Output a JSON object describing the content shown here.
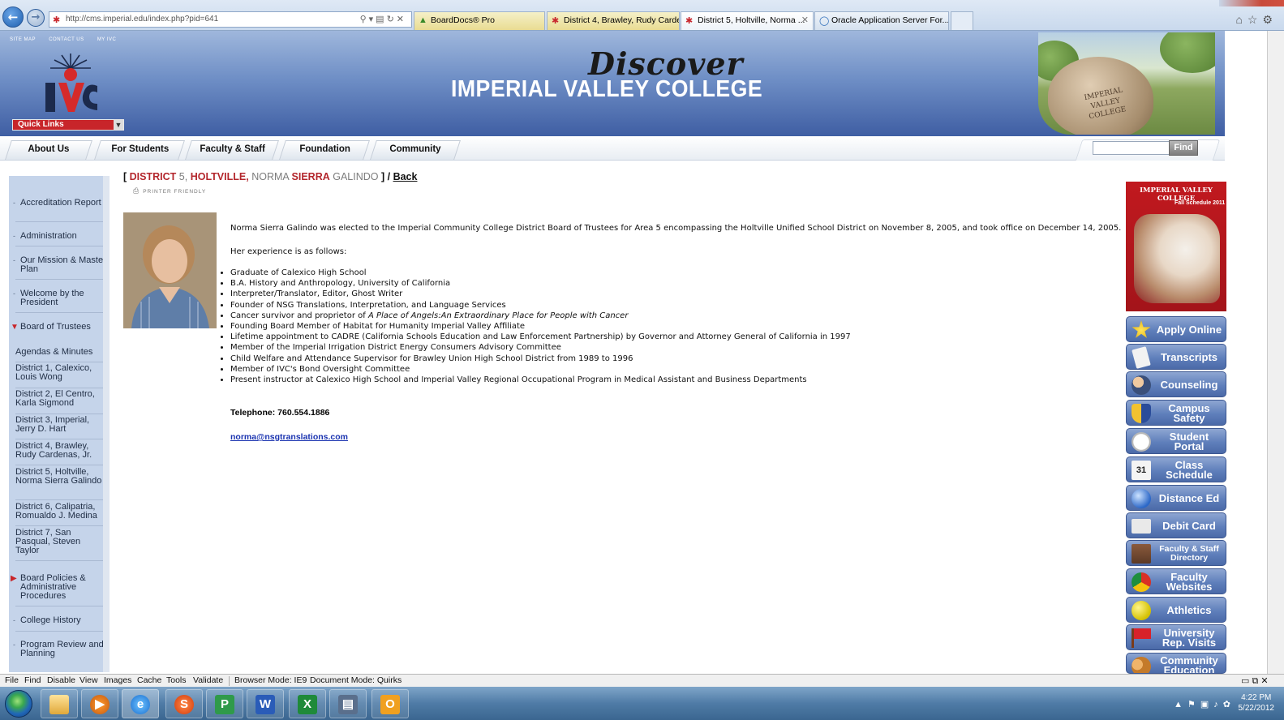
{
  "browser": {
    "url": "http://cms.imperial.edu/index.php?pid=641",
    "tabs": [
      {
        "label": "BoardDocs® Pro",
        "icon": "boarddocs-icon"
      },
      {
        "label": "District 4, Brawley, Rudy Carde...",
        "icon": "ivc-favicon"
      },
      {
        "label": "District 5, Holtville, Norma ...",
        "icon": "ivc-favicon",
        "active": true
      },
      {
        "label": "Oracle Application Server For...",
        "icon": "ie-icon"
      }
    ]
  },
  "header": {
    "util_links": [
      "SITE MAP",
      "CONTACT US",
      "MY IVC"
    ],
    "quick_links": "Quick Links",
    "discover": "Discover",
    "college_name": "IMPERIAL VALLEY COLLEGE",
    "photo_sign": "IMPERIAL VALLEY COLLEGE"
  },
  "nav": {
    "items": [
      "About Us",
      "For Students",
      "Faculty & Staff",
      "Foundation",
      "Community"
    ],
    "find_label": "Find",
    "search_value": ""
  },
  "sidebar": {
    "items": [
      {
        "label": "Accreditation Report"
      },
      {
        "label": "Administration"
      },
      {
        "label": "Our Mission & Master Plan"
      },
      {
        "label": "Welcome by the President"
      },
      {
        "label": "Board of Trustees"
      },
      {
        "label": "Agendas & Minutes"
      },
      {
        "label": "District 1, Calexico, Louis Wong"
      },
      {
        "label": "District 2, El Centro, Karla Sigmond"
      },
      {
        "label": "District 3, Imperial, Jerry D. Hart"
      },
      {
        "label": "District 4, Brawley, Rudy Cardenas, Jr."
      },
      {
        "label": "District 5, Holtville, Norma Sierra Galindo"
      },
      {
        "label": "District 6, Calipatria, Romualdo J. Medina"
      },
      {
        "label": "District 7, San Pasqual, Steven Taylor"
      },
      {
        "label": "Board Policies & Administrative Procedures"
      },
      {
        "label": "College History"
      },
      {
        "label": "Program Review and Planning"
      }
    ]
  },
  "main": {
    "title": {
      "open_bracket": "[",
      "district": "DISTRICT",
      "district_num": "5,",
      "city": "HOLTVILLE,",
      "first": "NORMA",
      "middle": "SIERRA",
      "last": "GALINDO",
      "close": "] /",
      "back": "Back"
    },
    "printer_friendly": "PRINTER FRIENDLY",
    "intro": "Norma Sierra Galindo was elected to the Imperial Community College District Board of Trustees for Area 5 encompassing the Holtville Unified School District on November 8, 2005, and took office on December 14, 2005.",
    "experience_heading": "Her experience is as follows:",
    "experience": [
      "Graduate of Calexico High School",
      "B.A. History and Anthropology, University of California",
      "Interpreter/Translator, Editor, Ghost Writer",
      "Founder of NSG Translations, Interpretation, and Language Services",
      "Cancer survivor and proprietor of ",
      "Founding Board Member of Habitat for Humanity Imperial Valley Affiliate",
      "Lifetime appointment to CADRE (California Schools Education and Law Enforcement Partnership) by Governor and Attorney General of California in 1997",
      "Member of the Imperial Irrigation District Energy Consumers Advisory Committee",
      "Child Welfare and Attendance Supervisor for Brawley Union High School District from 1989 to 1996",
      "Member of IVC's Bond Oversight Committee",
      "Present instructor at Calexico High School and Imperial Valley Regional Occupational Program in Medical Assistant and Business Departments"
    ],
    "book_title": "A Place of Angels:An Extraordinary Place for People with Cancer",
    "telephone": "Telephone: 760.554.1886",
    "email": "norma@nsgtranslations.com"
  },
  "right": {
    "ad_title": "IMPERIAL VALLEY COLLEGE",
    "ad_subtitle": "Fall Schedule 2011",
    "buttons": [
      {
        "label": "Apply Online",
        "icon": "star-icon"
      },
      {
        "label": "Transcripts",
        "icon": "document-icon"
      },
      {
        "label": "Counseling",
        "icon": "people-icon"
      },
      {
        "label": "Campus Safety",
        "icon": "shield-icon"
      },
      {
        "label": "Student Portal",
        "icon": "clock-icon"
      },
      {
        "label": "Class Schedule",
        "icon": "calendar-icon",
        "badge": "31"
      },
      {
        "label": "Distance Ed",
        "icon": "globe-icon"
      },
      {
        "label": "Debit Card",
        "icon": "card-icon"
      },
      {
        "label": "Faculty & Staff Directory",
        "icon": "book-icon"
      },
      {
        "label": "Faculty Websites",
        "icon": "chrome-icon"
      },
      {
        "label": "Athletics",
        "icon": "ball-icon"
      },
      {
        "label": "University Rep. Visits",
        "icon": "flag-icon"
      },
      {
        "label": "Community Education",
        "icon": "group-icon"
      }
    ]
  },
  "devbar": {
    "items": [
      "File",
      "Find",
      "Disable",
      "View",
      "Images",
      "Cache",
      "Tools",
      "Validate",
      "Browser Mode: IE9",
      "Document Mode: Quirks"
    ]
  },
  "taskbar": {
    "time": "4:22 PM",
    "date": "5/22/2012"
  }
}
